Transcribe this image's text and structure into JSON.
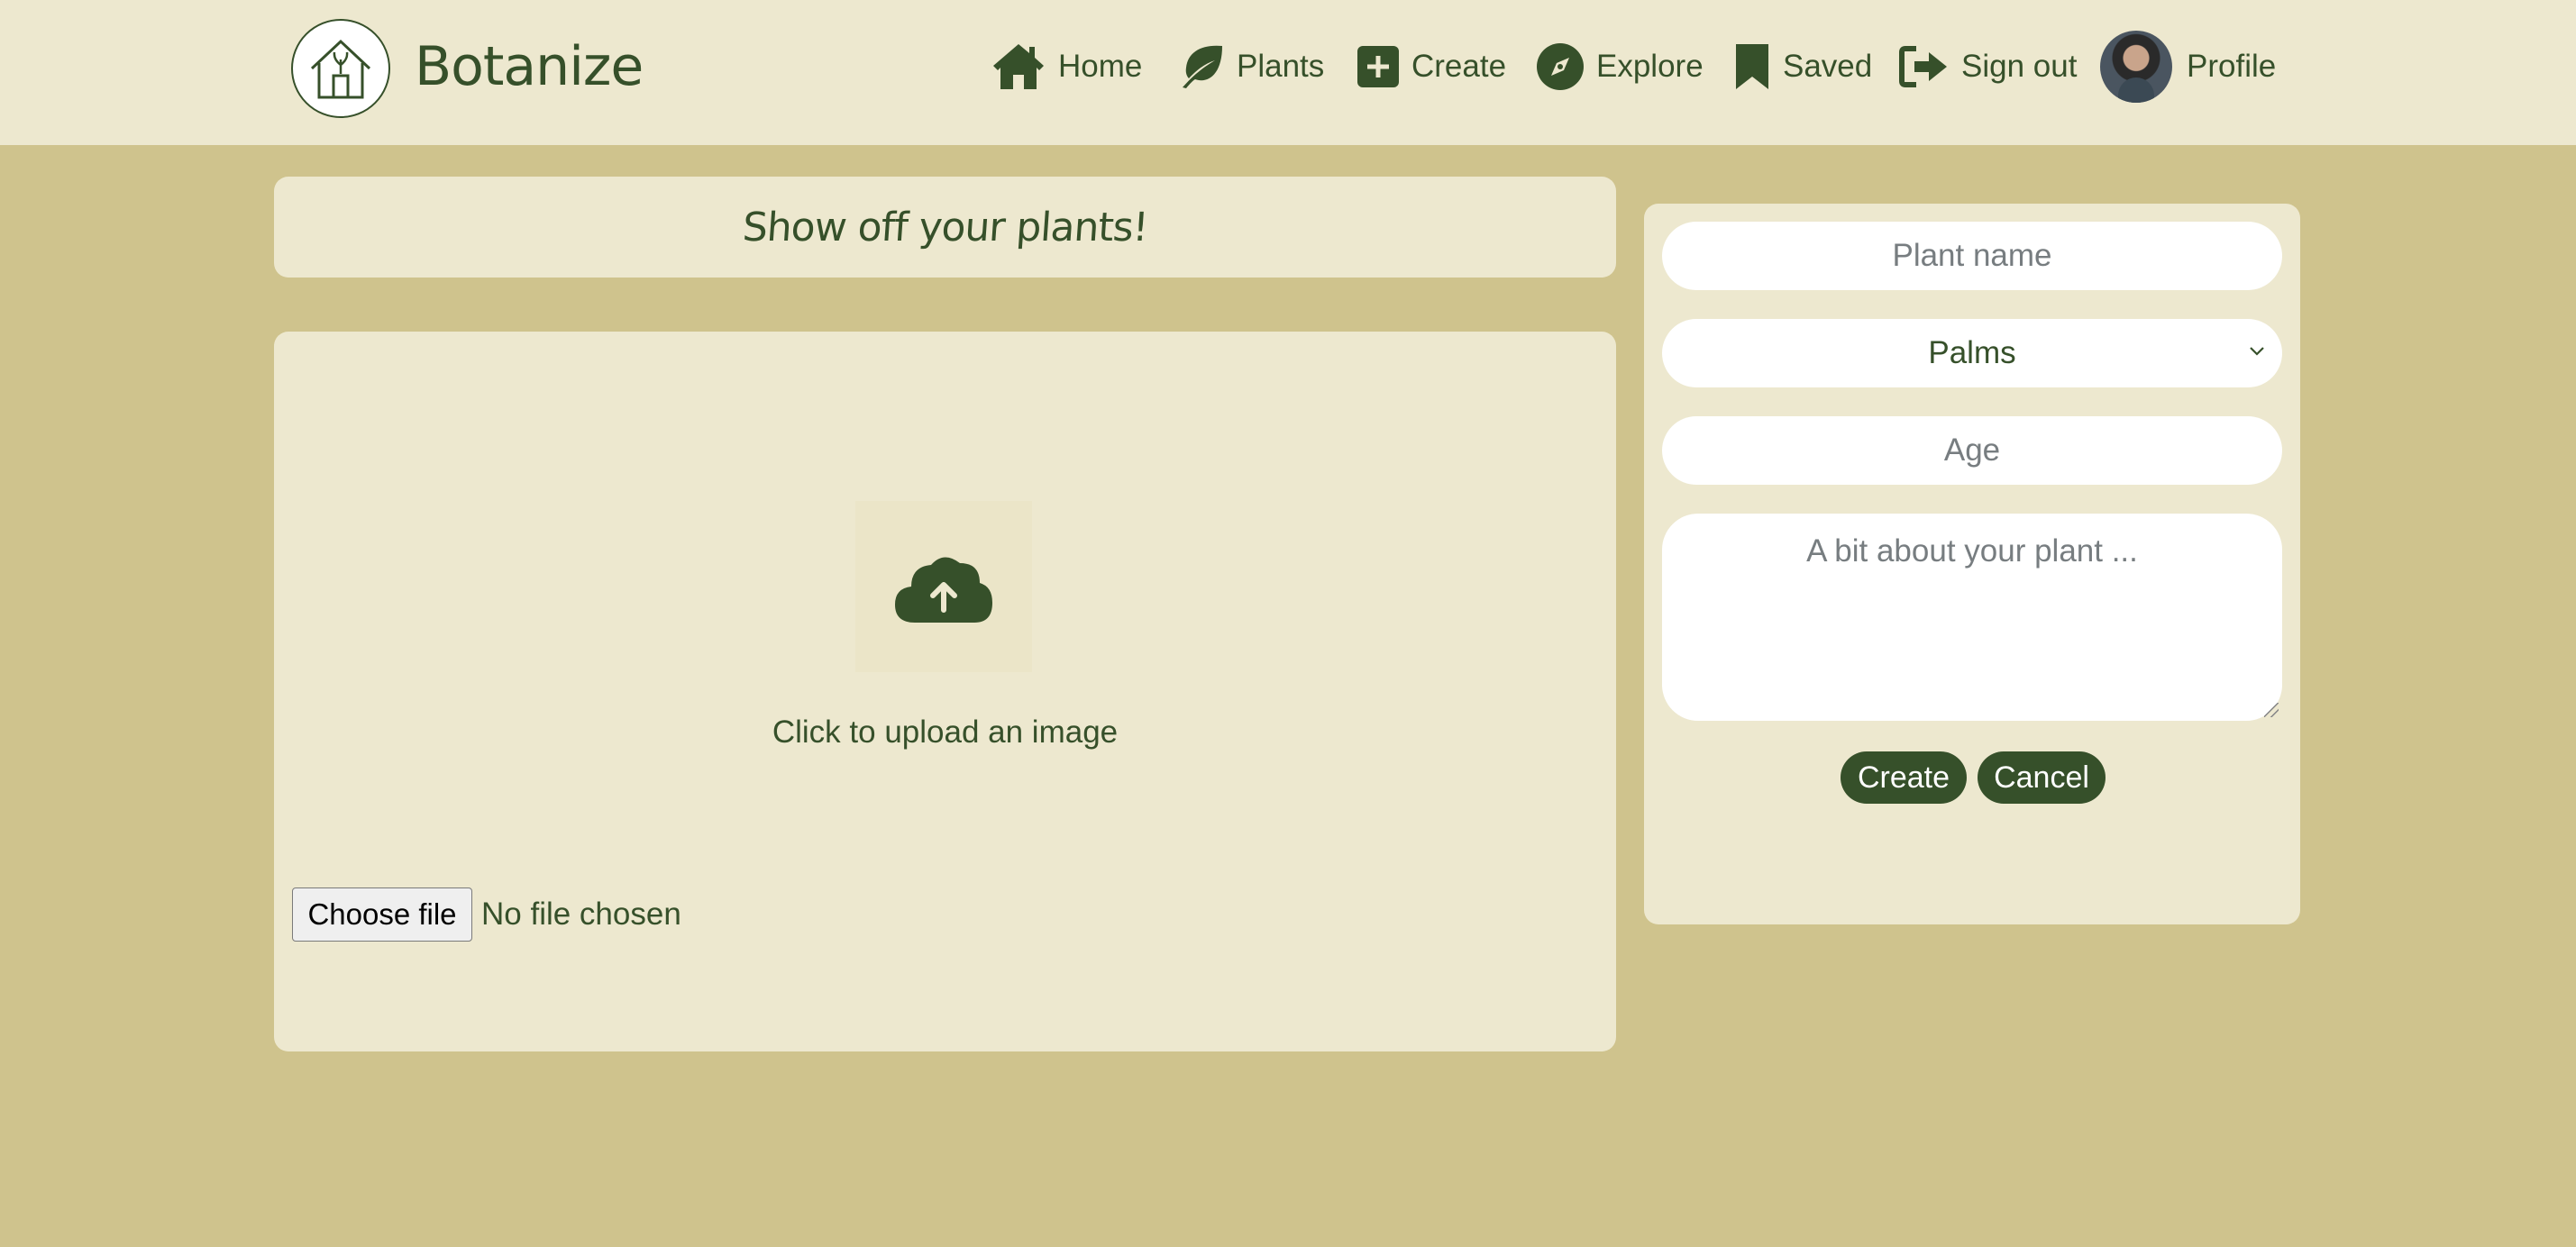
{
  "header": {
    "brand": "Botanize",
    "nav": [
      {
        "label": "Home",
        "icon": "home-icon"
      },
      {
        "label": "Plants",
        "icon": "leaf-icon"
      },
      {
        "label": "Create",
        "icon": "plus-square-icon"
      },
      {
        "label": "Explore",
        "icon": "compass-icon"
      },
      {
        "label": "Saved",
        "icon": "bookmark-icon"
      },
      {
        "label": "Sign out",
        "icon": "sign-out-icon"
      },
      {
        "label": "Profile",
        "icon": "avatar"
      }
    ]
  },
  "main": {
    "title": "Show off your plants!",
    "upload": {
      "text": "Click to upload an image",
      "choose_label": "Choose file",
      "file_status": "No file chosen"
    }
  },
  "form": {
    "plant_name_placeholder": "Plant name",
    "type_selected": "Palms",
    "age_placeholder": "Age",
    "description_placeholder": "A bit about your plant ...",
    "create_label": "Create",
    "cancel_label": "Cancel"
  },
  "colors": {
    "background": "#cfc38d",
    "card": "#ede8cf",
    "accent": "#36502a",
    "field": "#ffffff"
  }
}
